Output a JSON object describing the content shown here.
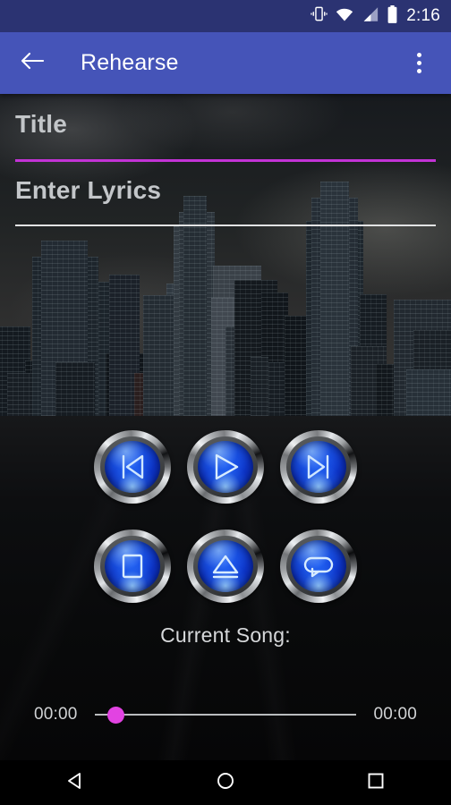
{
  "status_bar": {
    "time": "2:16",
    "icons": [
      "vibrate-icon",
      "wifi-icon",
      "cellular-signal-icon",
      "battery-icon"
    ],
    "background_color": "#2b3372"
  },
  "app_bar": {
    "title": "Rehearse",
    "back_icon": "back-arrow-icon",
    "overflow_icon": "overflow-menu-icon",
    "background_color": "#4554b8"
  },
  "form": {
    "title_field": {
      "placeholder": "Title",
      "value": "",
      "underline_color": "#c333d6",
      "focused": true
    },
    "lyrics_field": {
      "placeholder": "Enter Lyrics",
      "value": "",
      "underline_color": "#e2e3e4",
      "focused": false
    }
  },
  "transport": {
    "row1": [
      {
        "name": "previous-button",
        "icon": "skip-previous-icon",
        "label": "Previous"
      },
      {
        "name": "play-button",
        "icon": "play-icon",
        "label": "Play"
      },
      {
        "name": "next-button",
        "icon": "skip-next-icon",
        "label": "Next"
      }
    ],
    "row2": [
      {
        "name": "stop-button",
        "icon": "stop-icon",
        "label": "Stop"
      },
      {
        "name": "eject-button",
        "icon": "eject-icon",
        "label": "Eject"
      },
      {
        "name": "repeat-button",
        "icon": "repeat-loop-icon",
        "label": "Repeat"
      }
    ]
  },
  "current_song": {
    "label": "Current Song:",
    "value": ""
  },
  "seek_bar": {
    "elapsed": "00:00",
    "remaining": "00:00",
    "progress_percent": 0,
    "thumb_color": "#e243e2",
    "track_color": "#b9bcbe"
  },
  "nav_bar": {
    "back_icon": "nav-back-icon",
    "home_icon": "nav-home-icon",
    "recents_icon": "nav-recents-icon"
  }
}
